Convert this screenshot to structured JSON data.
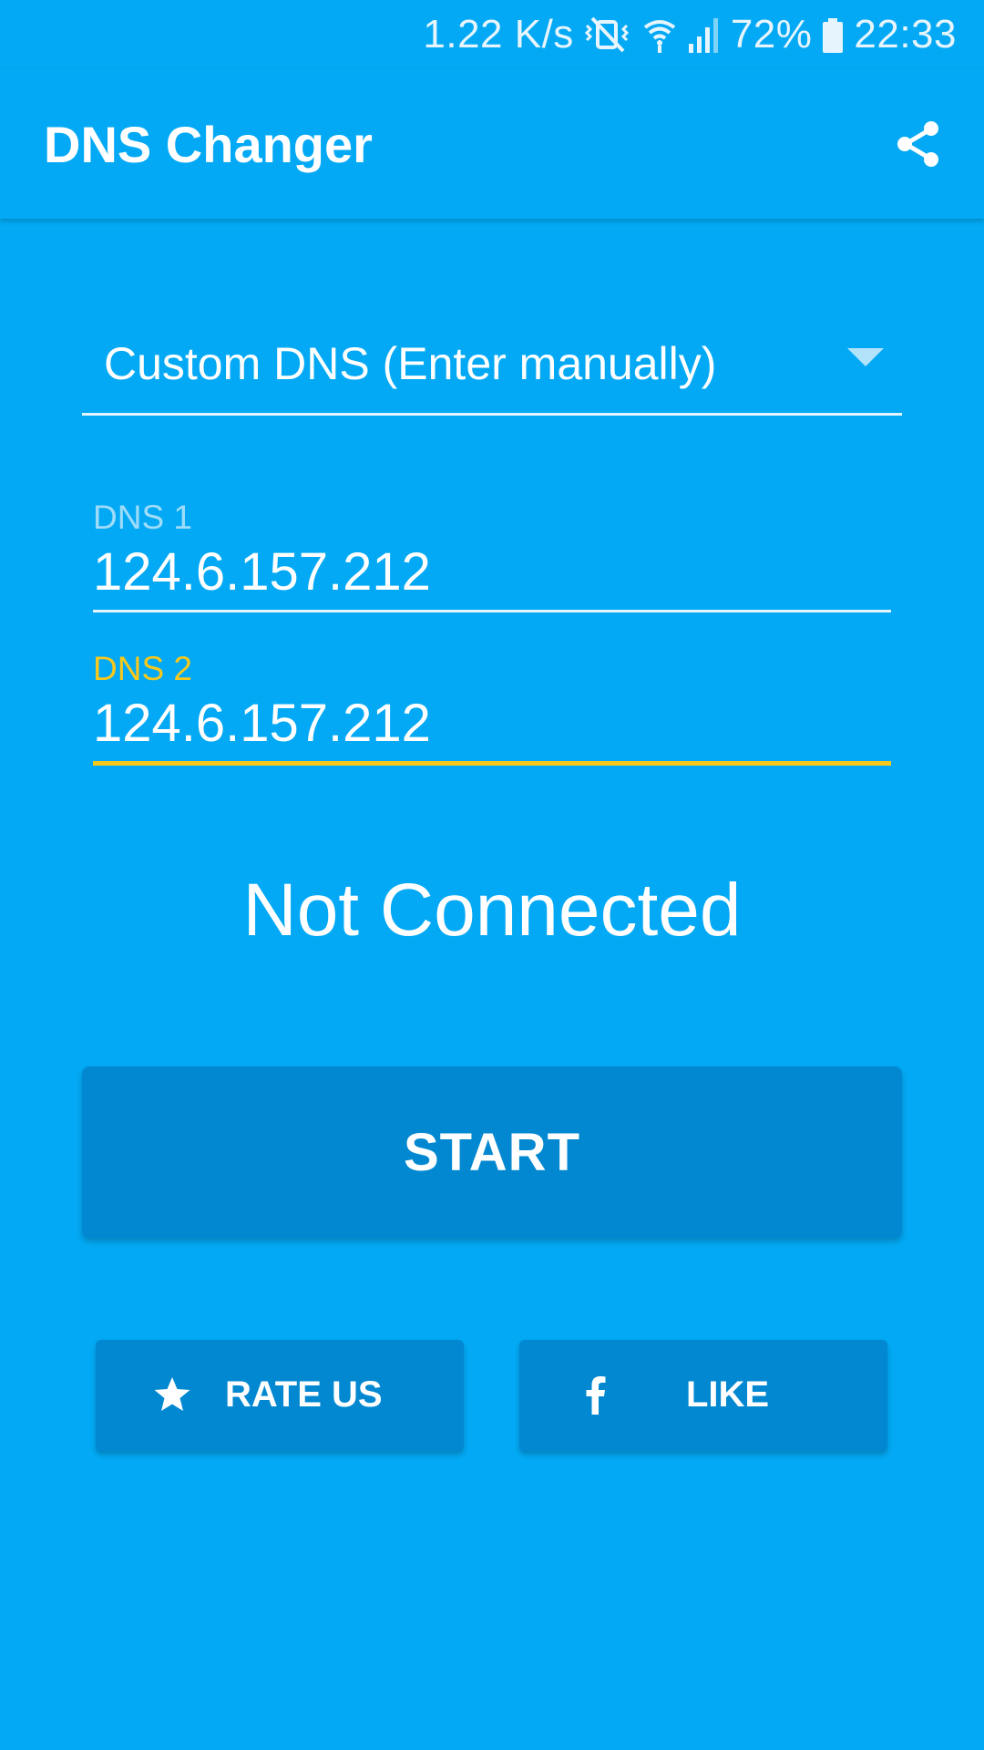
{
  "status_bar": {
    "net_speed": "1.22 K/s",
    "battery_percent": "72%",
    "time": "22:33",
    "icons": [
      "vibrate-muted-icon",
      "wifi-icon",
      "signal-icon",
      "battery-icon"
    ]
  },
  "app_bar": {
    "title": "DNS Changer",
    "share_icon": "share-icon"
  },
  "dns_select": {
    "selected": "Custom DNS (Enter manually)"
  },
  "dns1": {
    "label": "DNS 1",
    "value": "124.6.157.212"
  },
  "dns2": {
    "label": "DNS 2",
    "value": "124.6.157.212"
  },
  "status": {
    "text": "Not Connected"
  },
  "buttons": {
    "start": "START",
    "rate": "RATE US",
    "like": "LIKE",
    "rate_icon": "star-icon",
    "like_icon": "facebook-icon"
  },
  "colors": {
    "background": "#03a9f4",
    "button": "#0288d1",
    "accent": "#f9c81c"
  }
}
